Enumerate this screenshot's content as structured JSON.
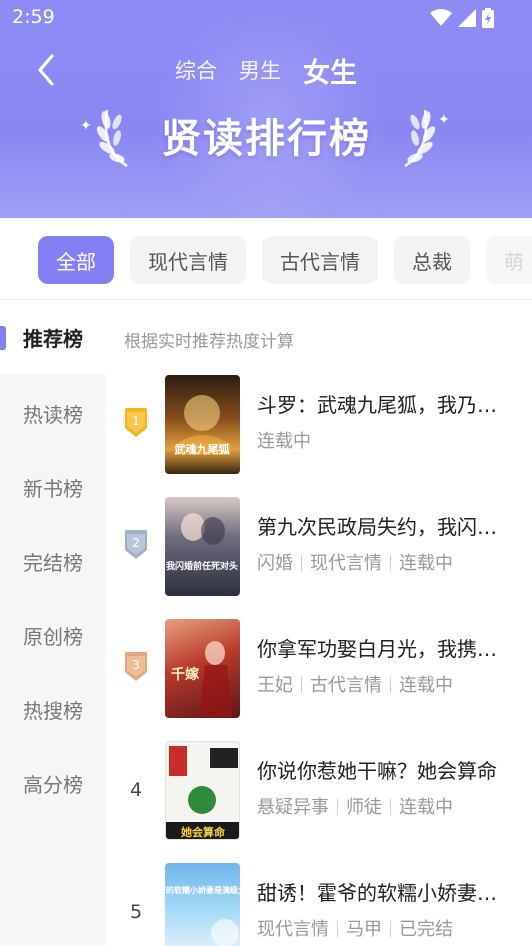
{
  "status_bar": {
    "time": "2:59"
  },
  "header": {
    "gender_tabs": [
      "综合",
      "男生",
      "女生"
    ],
    "active_gender": "女生",
    "banner_title": "贤读排行榜"
  },
  "categories": [
    "全部",
    "现代言情",
    "古代言情",
    "总裁",
    "萌"
  ],
  "active_category": "全部",
  "sidebar": {
    "items": [
      "推荐榜",
      "热读榜",
      "新书榜",
      "完结榜",
      "原创榜",
      "热搜榜",
      "高分榜"
    ],
    "active": "推荐榜"
  },
  "list": {
    "hint": "根据实时推荐热度计算",
    "books": [
      {
        "rank": "1",
        "title": "斗罗：武魂九尾狐，我乃妖族之皇",
        "tags": [
          "连载中"
        ],
        "cover_colors": [
          "#3a2a1a",
          "#c97a2a",
          "#f3c46a"
        ],
        "cover_text": "武魂九尾狐"
      },
      {
        "rank": "2",
        "title": "第九次民政局失约，我闪婚前任死对头",
        "tags": [
          "闪婚",
          "现代言情",
          "连载中"
        ],
        "cover_colors": [
          "#2b2f3d",
          "#7d7f93",
          "#d9c8c6"
        ],
        "cover_text": "我闪婚前任死对头"
      },
      {
        "rank": "3",
        "title": "你拿军功娶白月光，我携子改嫁",
        "tags": [
          "王妃",
          "古代言情",
          "连载中"
        ],
        "cover_colors": [
          "#5b1818",
          "#b8392c",
          "#e8a07c"
        ],
        "cover_text": "千嫁"
      },
      {
        "rank": "4",
        "title": "你说你惹她干嘛？她会算命",
        "tags": [
          "悬疑异事",
          "师徒",
          "连载中"
        ],
        "cover_colors": [
          "#f4f4f0",
          "#2e8b3c",
          "#c92a2a"
        ],
        "cover_text": "她会算命"
      },
      {
        "rank": "5",
        "title": "甜诱！霍爷的软糯小娇妻是满级大佬",
        "tags": [
          "现代言情",
          "马甲",
          "已完结"
        ],
        "cover_colors": [
          "#6fb6ea",
          "#a9dcf6",
          "#f2f7fb"
        ],
        "cover_text": "霍爷的软糯小娇妻是满级大佬"
      }
    ]
  },
  "colors": {
    "accent": "#8480f3",
    "header": "#8e8cf4",
    "gold": "#f5b41c",
    "silver": "#9fb0c6",
    "bronze": "#e4a67a"
  }
}
